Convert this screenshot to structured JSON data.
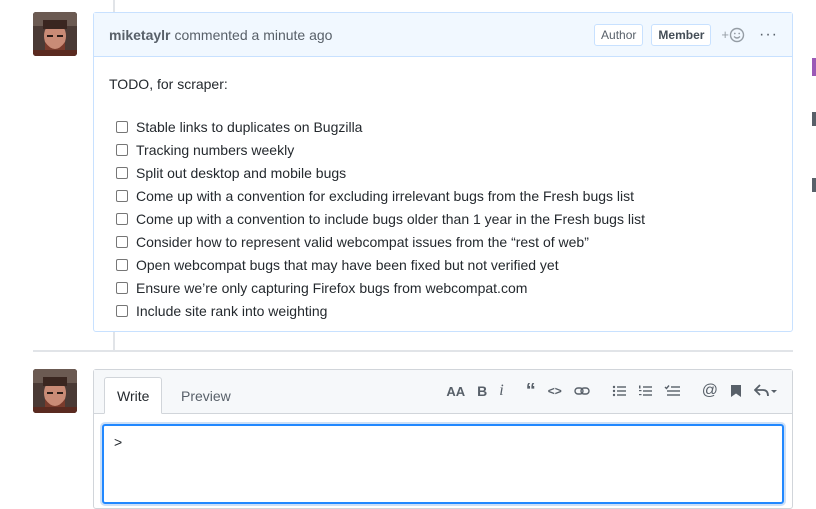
{
  "comment": {
    "author": "miketaylr",
    "meta": "commented a minute ago",
    "badges": [
      "Author",
      "Member"
    ],
    "reaction_plus": "+",
    "more": "···",
    "todo_title": "TODO, for scraper:",
    "tasks": [
      "Stable links to duplicates on Bugzilla",
      "Tracking numbers weekly",
      "Split out desktop and mobile bugs",
      "Come up with a convention for excluding irrelevant bugs from the Fresh bugs list",
      "Come up with a convention to include bugs older than 1 year in the Fresh bugs list",
      "Consider how to represent valid webcompat issues from the “rest of web”",
      "Open webcompat bugs that may have been fixed but not verified yet",
      "Ensure we’re only capturing Firefox bugs from webcompat.com",
      "Include site rank into weighting"
    ]
  },
  "editor": {
    "tabs": [
      "Write",
      "Preview"
    ],
    "toolbar": {
      "text_size": "AA",
      "bold": "B",
      "italic": "i",
      "quote": "“",
      "code": "<>",
      "mention": "@"
    },
    "value": ">"
  },
  "colors": {
    "header_bg": "#f1f8ff",
    "header_border": "#c8e1ff",
    "focus": "#2188ff"
  }
}
